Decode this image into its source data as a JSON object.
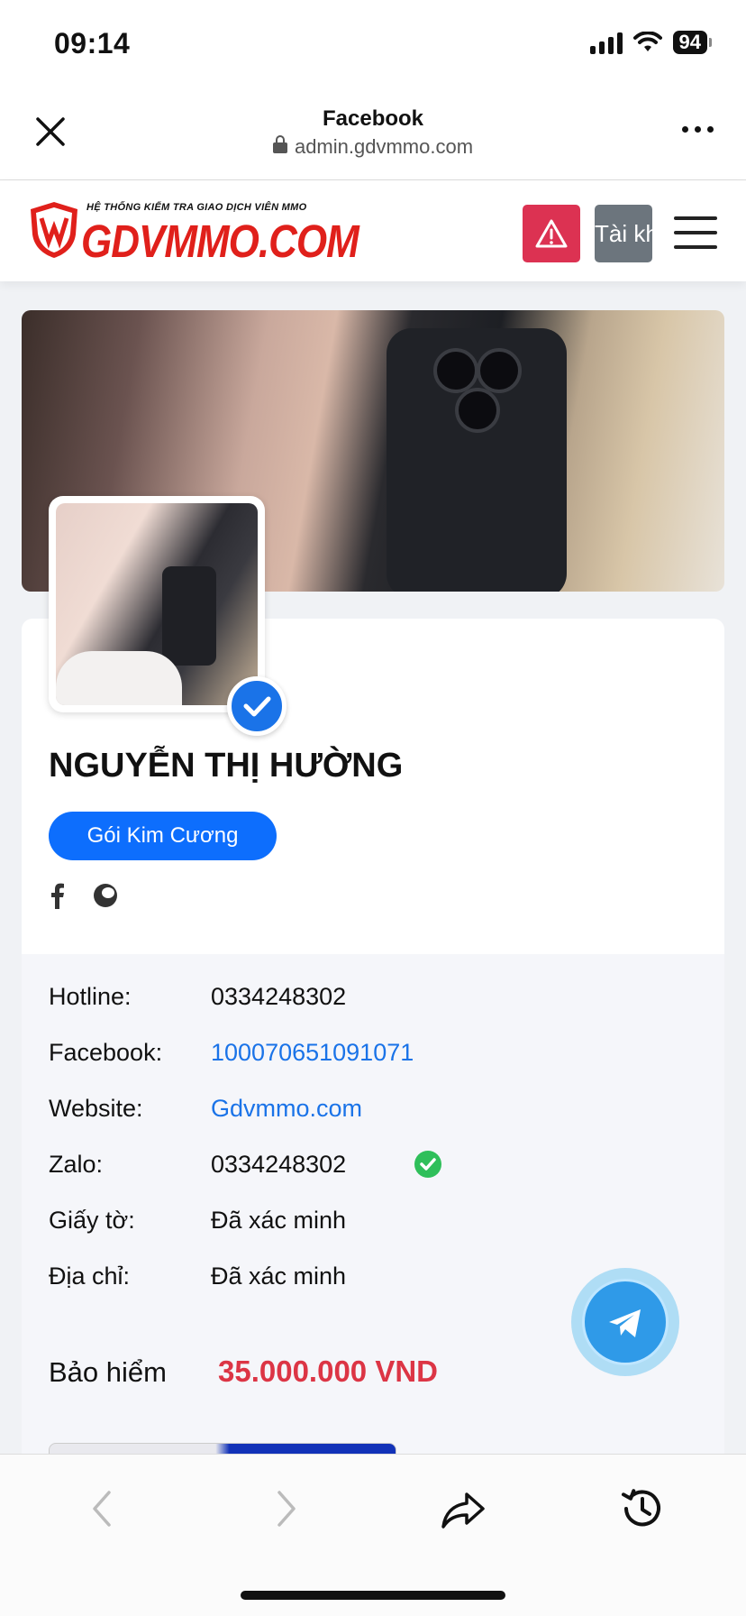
{
  "status_bar": {
    "time": "09:14",
    "battery": "94"
  },
  "browser": {
    "title": "Facebook",
    "url": "admin.gdvmmo.com"
  },
  "site": {
    "logo_tagline": "HỆ THỐNG KIỂM TRA GIAO DỊCH VIÊN MMO",
    "logo_text": "GDVMMO.COM",
    "account_button": "Tài khoản"
  },
  "profile": {
    "name": "NGUYỄN THỊ HƯỜNG",
    "package": "Gói Kim Cương",
    "info": [
      {
        "label": "Hotline:",
        "value": "0334248302"
      },
      {
        "label": "Facebook:",
        "value": "100070651091071"
      },
      {
        "label": "Website:",
        "value": "Gdvmmo.com"
      },
      {
        "label": "Zalo:",
        "value": "0334248302"
      },
      {
        "label": "Giấy tờ:",
        "value": "Đã xác minh"
      },
      {
        "label": "Địa chỉ:",
        "value": "Đã xác minh"
      }
    ],
    "insurance_label": "Bảo hiểm",
    "insurance_value": "35.000.000 VND"
  },
  "colors": {
    "accent": "#0d6efd",
    "danger": "#dc3545",
    "alert": "#dc3252",
    "link": "#1a73e8"
  }
}
